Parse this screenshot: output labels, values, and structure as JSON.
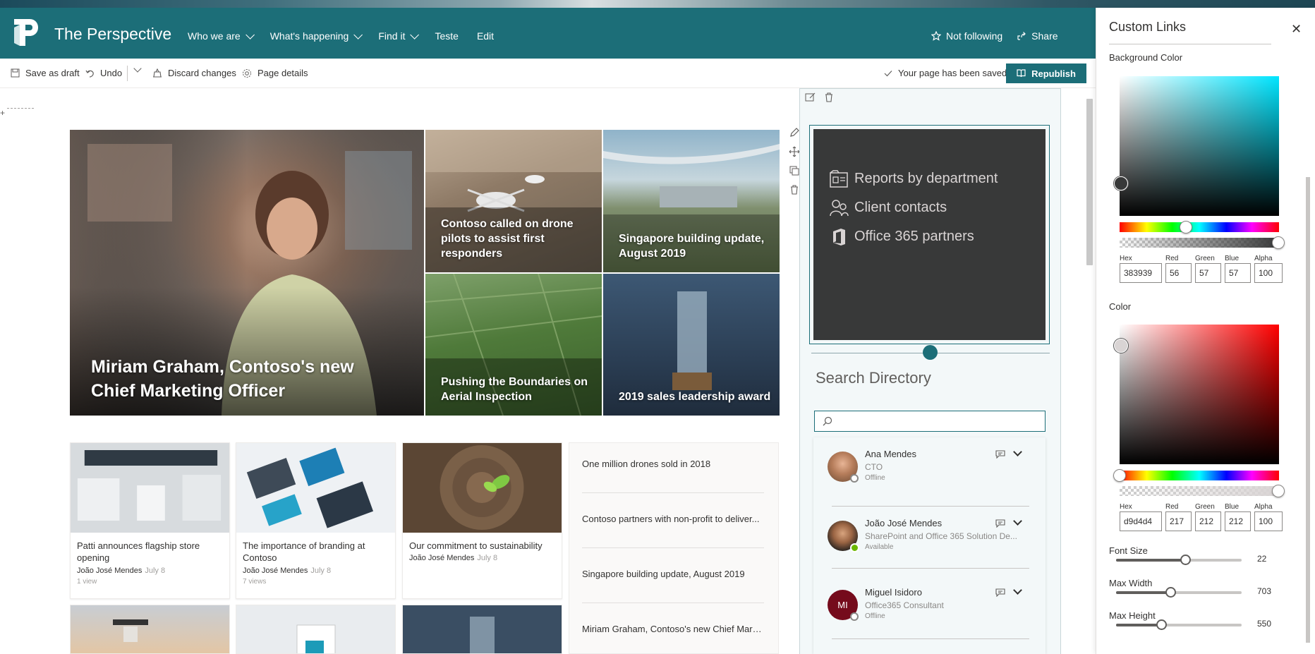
{
  "site": {
    "title": "The Perspective",
    "nav": [
      {
        "label": "Who we are",
        "has_menu": true
      },
      {
        "label": "What's happening",
        "has_menu": true
      },
      {
        "label": "Find it",
        "has_menu": true
      },
      {
        "label": "Teste",
        "has_menu": false
      },
      {
        "label": "Edit",
        "has_menu": false
      }
    ],
    "not_following": "Not following",
    "share": "Share",
    "accent": "#1c6e78"
  },
  "commandbar": {
    "save_draft": "Save as draft",
    "undo": "Undo",
    "discard": "Discard changes",
    "page_details": "Page details",
    "saved_msg": "Your page has been saved",
    "republish": "Republish"
  },
  "hero": {
    "main": "Miriam Graham, Contoso's new Chief Marketing Officer",
    "tiles": [
      "Contoso called on drone pilots to assist first responders",
      "Singapore building update, August 2019",
      "Pushing the Boundaries on Aerial Inspection",
      "2019 sales leadership award"
    ]
  },
  "news_cards": [
    {
      "title": "Patti announces flagship store opening",
      "author": "João José Mendes",
      "date": "July 8",
      "views": "1 view"
    },
    {
      "title": "The importance of branding at Contoso",
      "author": "João José Mendes",
      "date": "July 8",
      "views": "7 views"
    },
    {
      "title": "Our commitment to sustainability",
      "author": "João José Mendes",
      "date": "July 8",
      "views": ""
    }
  ],
  "news_list": [
    "One million drones sold in 2018",
    "Contoso partners with non-profit to deliver...",
    "Singapore building update, August 2019",
    "Miriam Graham, Contoso's new Chief Mark..."
  ],
  "custom_links": {
    "background": "#383939",
    "color": "#d9d4d4",
    "items": [
      {
        "label": "Reports by department",
        "icon": "reports-icon"
      },
      {
        "label": "Client contacts",
        "icon": "contacts-icon"
      },
      {
        "label": "Office 365 partners",
        "icon": "office-icon"
      }
    ]
  },
  "search_directory": {
    "title": "Search Directory",
    "placeholder": "",
    "people": [
      {
        "name": "Ana Mendes",
        "title": "CTO",
        "status": "Offline",
        "initials": "",
        "presence": "offline"
      },
      {
        "name": "João José Mendes",
        "title": "SharePoint and Office 365 Solution De...",
        "status": "Available",
        "initials": "",
        "presence": "available"
      },
      {
        "name": "Miguel Isidoro",
        "title": "Office365 Consultant",
        "status": "Offline",
        "initials": "MI",
        "presence": "offline"
      }
    ]
  },
  "pane": {
    "title": "Custom Links",
    "background_color": {
      "label": "Background Color",
      "hex_label": "Hex",
      "red_label": "Red",
      "green_label": "Green",
      "blue_label": "Blue",
      "alpha_label": "Alpha",
      "hex": "383939",
      "red": "56",
      "green": "57",
      "blue": "57",
      "alpha": "100",
      "hue_color": "#00e5ff"
    },
    "color": {
      "label": "Color",
      "hex_label": "Hex",
      "red_label": "Red",
      "green_label": "Green",
      "blue_label": "Blue",
      "alpha_label": "Alpha",
      "hex": "d9d4d4",
      "red": "217",
      "green": "212",
      "blue": "212",
      "alpha": "100",
      "hue_color": "#ff0000"
    },
    "font_size": {
      "label": "Font Size",
      "value": "22",
      "fraction": 0.55
    },
    "max_width": {
      "label": "Max Width",
      "value": "703",
      "fraction": 0.43
    },
    "max_height": {
      "label": "Max Height",
      "value": "550",
      "fraction": 0.36
    }
  }
}
